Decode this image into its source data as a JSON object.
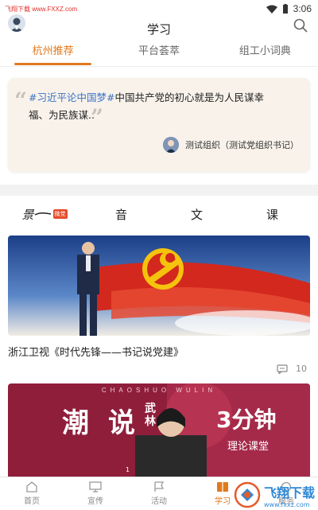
{
  "status_bar": {
    "watermark": "飞翔下载 www.FXXZ.com",
    "time": "3:06"
  },
  "header": {
    "title": "学习",
    "avatar_icon": "user-avatar",
    "search_icon": "search-icon"
  },
  "tabs": [
    {
      "label": "杭州推荐",
      "active": true
    },
    {
      "label": "平台荟萃",
      "active": false
    },
    {
      "label": "组工小词典",
      "active": false
    }
  ],
  "quote": {
    "tag": "#习近平论中国梦#",
    "text_line1": "中国共产党的初心就是为人民谋幸",
    "text_line2": "福、为民族谋..",
    "author": "测试组织（测试党组织书记）"
  },
  "sound_row": {
    "logo_text": "景",
    "logo_badge": "微党",
    "items": [
      "音",
      "文",
      "课"
    ]
  },
  "videos": [
    {
      "title": "浙江卫视《时代先锋——书记说党建》",
      "comments": "10"
    },
    {
      "banner_top": "CHAOSHUO WULIN",
      "banner_main1": "潮",
      "banner_main2": "说",
      "banner_main3": "武林",
      "banner_side": "3分钟",
      "banner_sub": "理论课堂",
      "corner": "1"
    }
  ],
  "bottom_nav": [
    {
      "label": "首页",
      "icon": "home-icon",
      "active": false
    },
    {
      "label": "宣传",
      "icon": "monitor-icon",
      "active": false
    },
    {
      "label": "活动",
      "icon": "flag-icon",
      "active": false
    },
    {
      "label": "学习",
      "icon": "book-icon",
      "active": true
    },
    {
      "label": "服务",
      "icon": "service-icon",
      "active": false
    }
  ],
  "watermark_bottom": {
    "main": "飞翔下载",
    "sub": "www.fxxz.com"
  },
  "colors": {
    "accent": "#e07a1f",
    "tag_blue": "#3a72c7",
    "watermark_red": "#e0302a"
  }
}
